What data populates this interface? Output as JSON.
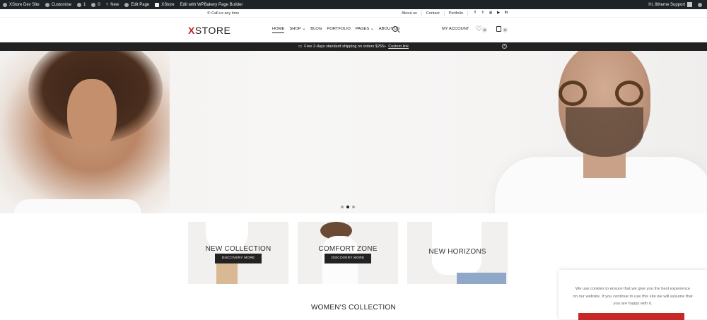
{
  "admin_bar": {
    "site": "XStore Dev Site",
    "customise": "Customise",
    "updates": "1",
    "comments": "0",
    "new": "New",
    "edit_page": "Edit Page",
    "xstore": "XStore",
    "wpbakery": "Edit with WPBakery Page Builder",
    "greeting": "Hi, 8theme Support"
  },
  "top_bar": {
    "call": "Call us any time",
    "links": [
      "About us",
      "Contact",
      "Portfolio"
    ],
    "socials": [
      "facebook-icon",
      "twitter-icon",
      "instagram-icon",
      "youtube-icon",
      "linkedin-icon"
    ]
  },
  "header": {
    "logo_x": "X",
    "logo_rest": "STORE",
    "nav": [
      "HOME",
      "SHOP",
      "BLOG",
      "PORTFOLIO",
      "PAGES",
      "ABOUT US"
    ],
    "account": "MY ACCOUNT",
    "wishlist_count": "0",
    "cart_count": "0",
    "brand_color": "#c62828"
  },
  "promo": {
    "text": "Free 2-days standard shipping on orders $255+",
    "link": "Custom link"
  },
  "hero": {
    "slides": 3,
    "active_slide": 2
  },
  "collections": [
    {
      "title": "NEW COLLECTION",
      "button": "DISCOVERY MORE"
    },
    {
      "title": "COMFORT ZONE",
      "button": "DISCOVERY MORE"
    },
    {
      "title": "NEW HORIZONS",
      "button": ""
    }
  ],
  "section_title": "WOMEN'S COLLECTION",
  "cookie": {
    "text": "We use cookies to ensure that we give you the best experience on our website. If you continue to use this site we will assume that you are happy with it."
  }
}
